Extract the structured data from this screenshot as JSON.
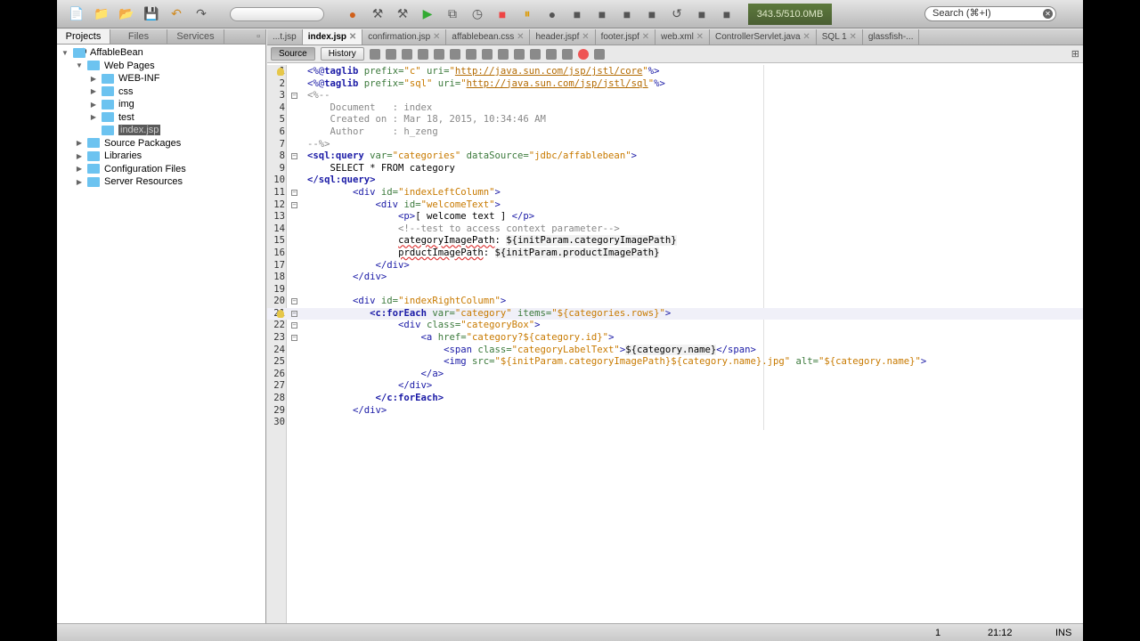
{
  "toolbar": {
    "memory": "343.5/510.0MB",
    "search_placeholder": "Search (⌘+I)"
  },
  "left_panel": {
    "tabs": [
      "Projects",
      "Files",
      "Services"
    ],
    "tree": [
      {
        "label": "AffableBean",
        "level": 0,
        "arrow": "▼",
        "icon": "globe-icon"
      },
      {
        "label": "Web Pages",
        "level": 1,
        "arrow": "▼",
        "icon": "web-folder-icon"
      },
      {
        "label": "WEB-INF",
        "level": 2,
        "arrow": "▶",
        "icon": "folder-icon"
      },
      {
        "label": "css",
        "level": 2,
        "arrow": "▶",
        "icon": "folder-icon"
      },
      {
        "label": "img",
        "level": 2,
        "arrow": "▶",
        "icon": "folder-icon"
      },
      {
        "label": "test",
        "level": 2,
        "arrow": "▶",
        "icon": "folder-icon"
      },
      {
        "label": "index.jsp",
        "level": 2,
        "arrow": "",
        "icon": "jsp-file-icon",
        "selected": true
      },
      {
        "label": "Source Packages",
        "level": 1,
        "arrow": "▶",
        "icon": "package-icon"
      },
      {
        "label": "Libraries",
        "level": 1,
        "arrow": "▶",
        "icon": "library-icon"
      },
      {
        "label": "Configuration Files",
        "level": 1,
        "arrow": "▶",
        "icon": "config-icon"
      },
      {
        "label": "Server Resources",
        "level": 1,
        "arrow": "▶",
        "icon": "server-icon"
      }
    ]
  },
  "editor": {
    "tabs": [
      "...t.jsp",
      "index.jsp",
      "confirmation.jsp",
      "affablebean.css",
      "header.jspf",
      "footer.jspf",
      "web.xml",
      "ControllerServlet.java",
      "SQL 1",
      "glassfish-..."
    ],
    "active_tab": 1,
    "source_label": "Source",
    "history_label": "History",
    "lines": [
      [
        [
          "<%@",
          "t"
        ],
        [
          "taglib",
          "d"
        ],
        [
          " prefix=",
          "a"
        ],
        [
          "\"c\"",
          "v"
        ],
        [
          " uri=",
          "a"
        ],
        [
          "\"",
          "v"
        ],
        [
          "http://java.sun.com/jsp/jstl/core",
          "u"
        ],
        [
          "\"",
          "v"
        ],
        [
          "%>",
          "t"
        ]
      ],
      [
        [
          "<%@",
          "t"
        ],
        [
          "taglib",
          "d"
        ],
        [
          " prefix=",
          "a"
        ],
        [
          "\"sql\"",
          "v"
        ],
        [
          " uri=",
          "a"
        ],
        [
          "\"",
          "v"
        ],
        [
          "http://java.sun.com/jsp/jstl/sql",
          "u"
        ],
        [
          "\"",
          "v"
        ],
        [
          "%>",
          "t"
        ]
      ],
      [
        [
          "<%--",
          "c"
        ]
      ],
      [
        [
          "    Document   : index",
          "c"
        ]
      ],
      [
        [
          "    Created on : Mar 18, 2015, 10:34:46 AM",
          "c"
        ]
      ],
      [
        [
          "    Author     : h_zeng",
          "c"
        ]
      ],
      [
        [
          "--%>",
          "c"
        ]
      ],
      [
        [
          "<sql:query",
          "d"
        ],
        [
          " var=",
          "a"
        ],
        [
          "\"categories\"",
          "v"
        ],
        [
          " dataSource=",
          "a"
        ],
        [
          "\"jdbc/affablebean\"",
          "v"
        ],
        [
          ">",
          "t"
        ]
      ],
      [
        [
          "    SELECT * FROM category",
          "p"
        ]
      ],
      [
        [
          "</sql:query>",
          "d"
        ]
      ],
      [
        [
          "        <div",
          "t"
        ],
        [
          " id=",
          "a"
        ],
        [
          "\"indexLeftColumn\"",
          "v"
        ],
        [
          ">",
          "t"
        ]
      ],
      [
        [
          "            <div",
          "t"
        ],
        [
          " id=",
          "a"
        ],
        [
          "\"welcomeText\"",
          "v"
        ],
        [
          ">",
          "t"
        ]
      ],
      [
        [
          "                <p>",
          "t"
        ],
        [
          "[ welcome text ] ",
          "p"
        ],
        [
          "</p>",
          "t"
        ]
      ],
      [
        [
          "                <!--test to access context parameter-->",
          "c"
        ]
      ],
      [
        [
          "                ",
          "p"
        ],
        [
          "categoryImagePath",
          "w"
        ],
        [
          ": ",
          "p"
        ],
        [
          "${initParam.categoryImagePath}",
          "e"
        ]
      ],
      [
        [
          "                ",
          "p"
        ],
        [
          "prductImagePath",
          "w"
        ],
        [
          ": ",
          "p"
        ],
        [
          "${initParam.productImagePath}",
          "e"
        ]
      ],
      [
        [
          "            </div>",
          "t"
        ]
      ],
      [
        [
          "        </div>",
          "t"
        ]
      ],
      [
        [
          "",
          "p"
        ]
      ],
      [
        [
          "        <div",
          "t"
        ],
        [
          " id=",
          "a"
        ],
        [
          "\"indexRightColumn\"",
          "v"
        ],
        [
          ">",
          "t"
        ]
      ],
      [
        [
          "           ",
          "p"
        ],
        [
          "<c:forEach",
          "d"
        ],
        [
          " var=",
          "a"
        ],
        [
          "\"category\"",
          "v"
        ],
        [
          " items=",
          "a"
        ],
        [
          "\"${categories.rows}\"",
          "v"
        ],
        [
          ">",
          "t"
        ]
      ],
      [
        [
          "                <div",
          "t"
        ],
        [
          " class=",
          "a"
        ],
        [
          "\"categoryBox\"",
          "v"
        ],
        [
          ">",
          "t"
        ]
      ],
      [
        [
          "                    <a",
          "t"
        ],
        [
          " href=",
          "a"
        ],
        [
          "\"category?${category.id}\"",
          "v"
        ],
        [
          ">",
          "t"
        ]
      ],
      [
        [
          "                        <span",
          "t"
        ],
        [
          " class=",
          "a"
        ],
        [
          "\"categoryLabelText\"",
          "v"
        ],
        [
          ">",
          "t"
        ],
        [
          "${category.name}",
          "e"
        ],
        [
          "</span>",
          "t"
        ]
      ],
      [
        [
          "                        <img",
          "t"
        ],
        [
          " src=",
          "a"
        ],
        [
          "\"${initParam.categoryImagePath}${category.name}.jpg\"",
          "v"
        ],
        [
          " alt=",
          "a"
        ],
        [
          "\"${category.name}\"",
          "v"
        ],
        [
          ">",
          "t"
        ]
      ],
      [
        [
          "                    </a>",
          "t"
        ]
      ],
      [
        [
          "                </div>",
          "t"
        ]
      ],
      [
        [
          "            </c:forEach>",
          "d"
        ]
      ],
      [
        [
          "        </div>",
          "t"
        ]
      ],
      [
        [
          "",
          "p"
        ]
      ]
    ],
    "fold_lines": [
      3,
      8,
      11,
      12,
      20,
      21,
      22,
      23
    ],
    "hint_lines": [
      1,
      21
    ],
    "current_line": 21
  },
  "status": {
    "notifications": "1",
    "position": "21:12",
    "mode": "INS"
  }
}
